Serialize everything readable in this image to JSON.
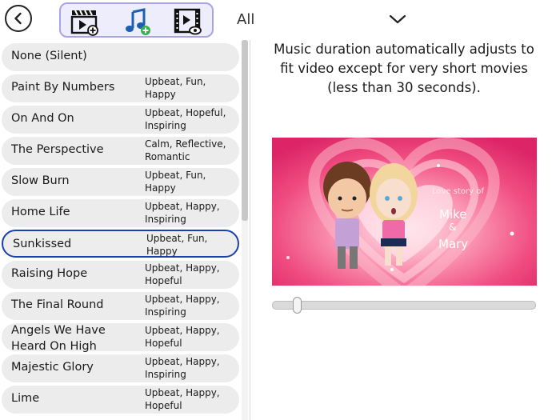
{
  "toolbar": {
    "back_icon": "back-arrow-icon",
    "icons": [
      "video-add-icon",
      "music-add-icon",
      "video-preview-icon"
    ],
    "accent_border": "#a9a3e8",
    "accent_bg": "#eeedfb",
    "music_icon_color": "#1a5fb4",
    "add_badge_color": "#2fb34a"
  },
  "filter": {
    "label": "All",
    "dropdown_icon": "chevron-down-icon"
  },
  "songs": [
    {
      "title": "None (Silent)",
      "tags": ""
    },
    {
      "title": "Paint By Numbers",
      "tags": "Upbeat, Fun, Happy"
    },
    {
      "title": "On And On",
      "tags": "Upbeat, Hopeful, Inspiring"
    },
    {
      "title": "The Perspective",
      "tags": "Calm, Reflective, Romantic"
    },
    {
      "title": "Slow Burn",
      "tags": "Upbeat, Fun, Happy"
    },
    {
      "title": "Home Life",
      "tags": "Upbeat, Happy, Inspiring"
    },
    {
      "title": "Sunkissed",
      "tags": "Upbeat, Fun, Happy",
      "selected": true
    },
    {
      "title": "Raising Hope",
      "tags": "Upbeat, Happy, Hopeful"
    },
    {
      "title": "The Final Round",
      "tags": "Upbeat, Happy, Inspiring"
    },
    {
      "title": "Angels We Have Heard On High",
      "tags": "Upbeat, Happy, Hopeful"
    },
    {
      "title": "Majestic Glory",
      "tags": "Upbeat, Happy, Inspiring"
    },
    {
      "title": "Lime",
      "tags": "Upbeat, Happy, Hopeful"
    }
  ],
  "selected_border_color": "#1b3fb0",
  "info": "Music duration automatically adjusts to fit video except for very short movies (less than 30 seconds).",
  "preview": {
    "caption_small": "Love story of",
    "name1": "Mike",
    "ampersand": "&",
    "name2": "Mary",
    "background_color": "#e8336f"
  },
  "timeline": {
    "position": 0.08
  }
}
